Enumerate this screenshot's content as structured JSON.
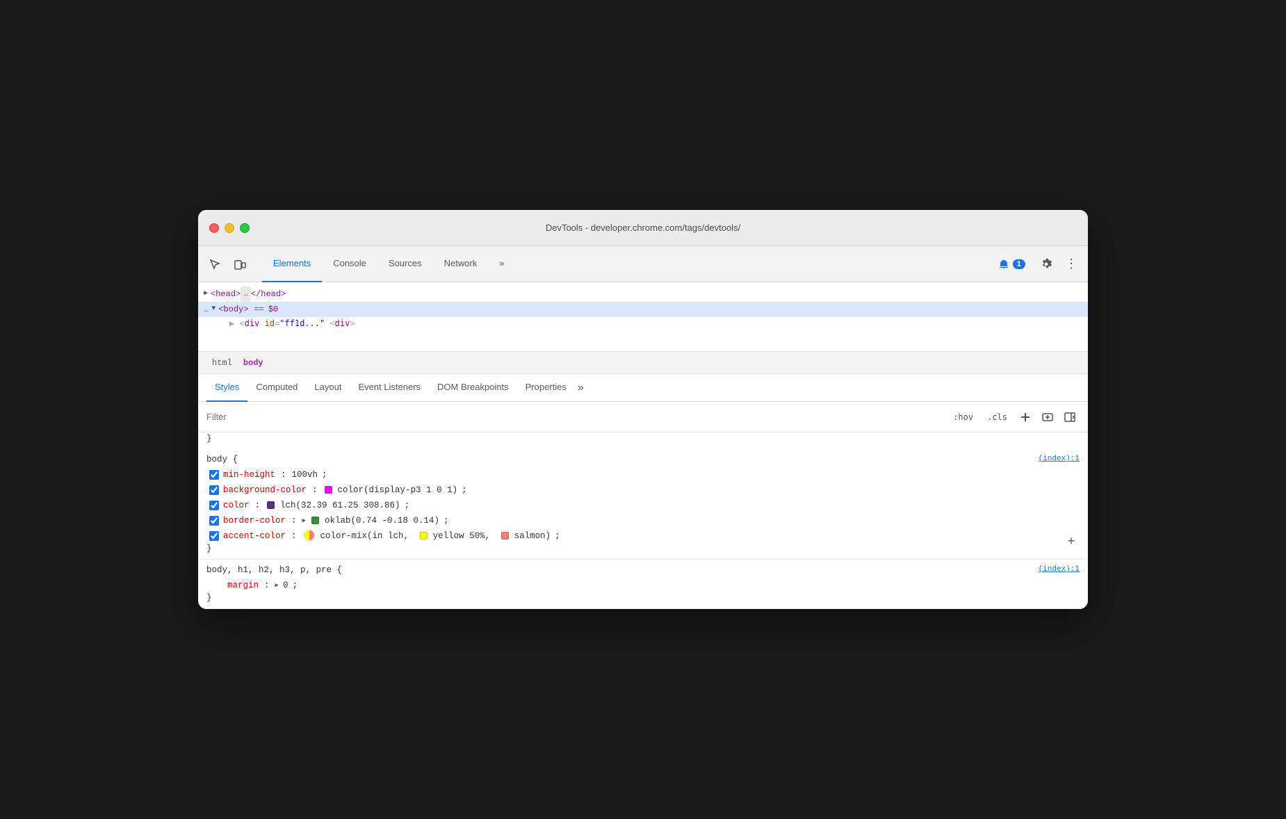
{
  "window": {
    "title": "DevTools - developer.chrome.com/tags/devtools/"
  },
  "topbar": {
    "tabs": [
      {
        "id": "elements",
        "label": "Elements",
        "active": true
      },
      {
        "id": "console",
        "label": "Console",
        "active": false
      },
      {
        "id": "sources",
        "label": "Sources",
        "active": false
      },
      {
        "id": "network",
        "label": "Network",
        "active": false
      },
      {
        "id": "more",
        "label": "»",
        "active": false
      }
    ],
    "notification_label": "1",
    "more_icon": "⋮"
  },
  "dom_tree": {
    "head_line": "▶ <head> … </head>",
    "body_line": "… ▼ <body> == $0"
  },
  "breadcrumb": {
    "items": [
      {
        "id": "html",
        "label": "html",
        "active": false
      },
      {
        "id": "body",
        "label": "body",
        "active": true
      }
    ]
  },
  "styles_tabs": {
    "tabs": [
      {
        "id": "styles",
        "label": "Styles",
        "active": true
      },
      {
        "id": "computed",
        "label": "Computed",
        "active": false
      },
      {
        "id": "layout",
        "label": "Layout",
        "active": false
      },
      {
        "id": "event-listeners",
        "label": "Event Listeners",
        "active": false
      },
      {
        "id": "dom-breakpoints",
        "label": "DOM Breakpoints",
        "active": false
      },
      {
        "id": "properties",
        "label": "Properties",
        "active": false
      },
      {
        "id": "more",
        "label": "»",
        "active": false
      }
    ]
  },
  "filter": {
    "placeholder": "Filter",
    "hov_label": ":hov",
    "cls_label": ".cls",
    "add_label": "+"
  },
  "css_rules": {
    "closing_brace": "}",
    "rule1": {
      "selector": "body {",
      "source": "(index):1",
      "properties": [
        {
          "id": "min-height",
          "checked": true,
          "name": "min-height",
          "value": "100vh",
          "semicolon": ";"
        },
        {
          "id": "background-color",
          "checked": true,
          "name": "background-color",
          "swatch_color": "#ff00ff",
          "value": "color(display-p3 1 0 1)",
          "semicolon": ";"
        },
        {
          "id": "color",
          "checked": true,
          "name": "color",
          "swatch_color": "#5c2f82",
          "value": "lch(32.39 61.25 308.86)",
          "semicolon": ";"
        },
        {
          "id": "border-color",
          "checked": true,
          "name": "border-color",
          "has_triangle": true,
          "swatch_color": "#3d8c40",
          "value": "oklab(0.74 -0.18 0.14)",
          "semicolon": ";"
        },
        {
          "id": "accent-color",
          "checked": true,
          "name": "accent-color",
          "has_mixed": true,
          "value": "color-mix(in lch,",
          "swatch_yellow": "#ffff00",
          "yellow_label": "yellow 50%,",
          "swatch_salmon": "#fa8072",
          "salmon_label": "salmon)",
          "semicolon": ";"
        }
      ],
      "closing": "}"
    },
    "rule2": {
      "selector": "body, h1, h2, h3, p, pre {",
      "source": "(index):1",
      "properties": [
        {
          "id": "margin",
          "name": "margin",
          "has_triangle": true,
          "value": "0",
          "semicolon": ";"
        }
      ],
      "closing": "}"
    }
  },
  "add_rule_btn": "+",
  "colors": {
    "accent_blue": "#1a73e8",
    "tag_purple": "#881280",
    "prop_red": "#c80000",
    "string_blue": "#1a1aa6",
    "attr_orange": "#994500"
  }
}
